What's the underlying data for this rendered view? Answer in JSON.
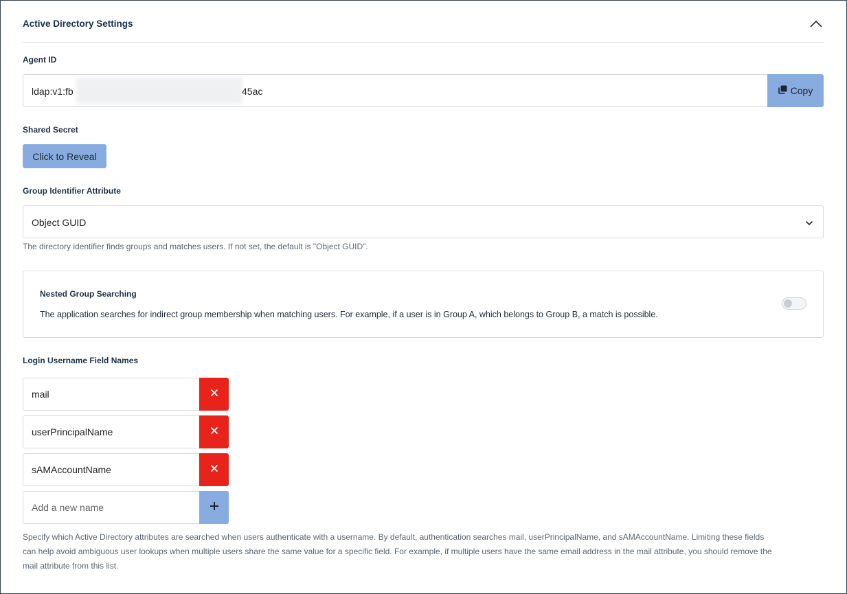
{
  "section": {
    "title": "Active Directory Settings",
    "collapse_icon": "chevron-up-icon"
  },
  "agent_id": {
    "label": "Agent ID",
    "value_prefix": "ldap:v1:fb",
    "value_suffix": "45ac",
    "copy_label": "Copy",
    "copy_icon": "copy-icon"
  },
  "shared_secret": {
    "label": "Shared Secret",
    "reveal_label": "Click to Reveal"
  },
  "group_identifier": {
    "label": "Group Identifier Attribute",
    "selected": "Object GUID",
    "help": "The directory identifier finds groups and matches users. If not set, the default is \"Object GUID\"."
  },
  "nested_group": {
    "title": "Nested Group Searching",
    "description": "The application searches for indirect group membership when matching users. For example, if a user is in Group A, which belongs to Group B, a match is possible.",
    "enabled": false
  },
  "login_fields": {
    "label": "Login Username Field Names",
    "items": [
      "mail",
      "userPrincipalName",
      "sAMAccountName"
    ],
    "add_placeholder": "Add a new name",
    "remove_icon": "close-icon",
    "add_icon": "plus-icon",
    "help_lines": [
      "Specify which Active Directory attributes are searched when users authenticate with a username. By default, authentication searches mail, userPrincipalName, and sAMAccountName. Limiting these fields",
      "can help avoid ambiguous user lookups when multiple users share the same value for a specific field. For example, if multiple users have the same email address in the mail attribute, you should remove the",
      "mail attribute from this list."
    ]
  },
  "colors": {
    "primary_button": "#89ace0",
    "danger_button": "#e8231b",
    "heading": "#15304f"
  }
}
